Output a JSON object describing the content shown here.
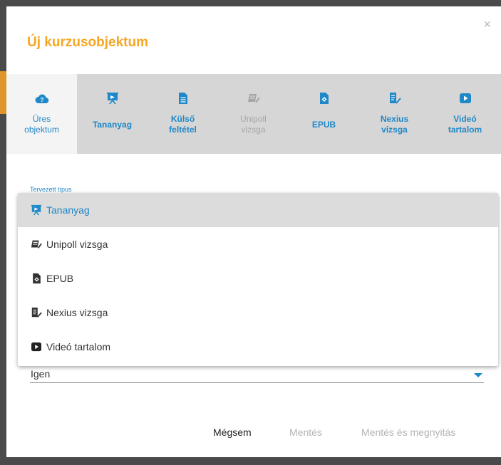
{
  "dialog": {
    "title": "Új kurzusobjektum",
    "close_label": "×"
  },
  "tabs": [
    {
      "label_line1": "Üres",
      "label_line2": "objektum",
      "icon": "cloud-question-icon",
      "state": "selected"
    },
    {
      "label_line1": "Tananyag",
      "label_line2": "",
      "icon": "presentation-icon",
      "state": "normal"
    },
    {
      "label_line1": "Külső",
      "label_line2": "feltétel",
      "icon": "document-icon",
      "state": "normal"
    },
    {
      "label_line1": "Unipoll",
      "label_line2": "vizsga",
      "icon": "exam-pen-icon",
      "state": "disabled"
    },
    {
      "label_line1": "EPUB",
      "label_line2": "",
      "icon": "epub-icon",
      "state": "normal"
    },
    {
      "label_line1": "Nexius",
      "label_line2": "vizsga",
      "icon": "checklist-pen-icon",
      "state": "normal"
    },
    {
      "label_line1": "Videó",
      "label_line2": "tartalom",
      "icon": "video-play-icon",
      "state": "normal"
    }
  ],
  "form": {
    "type_label": "Tervezett típus",
    "select_value": "Igen"
  },
  "dropdown": {
    "options": [
      {
        "label": "Tananyag",
        "icon": "presentation-icon",
        "active": true
      },
      {
        "label": "Unipoll vizsga",
        "icon": "exam-pen-icon",
        "active": false
      },
      {
        "label": "EPUB",
        "icon": "epub-icon",
        "active": false
      },
      {
        "label": "Nexius vizsga",
        "icon": "checklist-pen-icon",
        "active": false
      },
      {
        "label": "Videó tartalom",
        "icon": "video-play-icon",
        "active": false
      }
    ]
  },
  "footer": {
    "cancel_label": "Mégsem",
    "save_label": "Mentés",
    "save_open_label": "Mentés és megnyitás"
  },
  "colors": {
    "accent": "#f5a623",
    "primary": "#1e88c8",
    "disabled": "#a6a6a6"
  }
}
